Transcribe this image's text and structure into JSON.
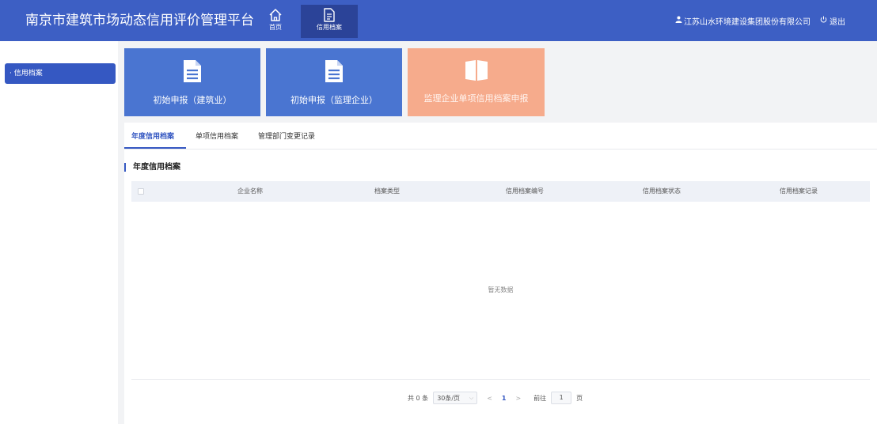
{
  "header": {
    "app_title": "南京市建筑市场动态信用评价管理平台",
    "nav": [
      {
        "label": "首页",
        "icon": "home-icon"
      },
      {
        "label": "信用档案",
        "icon": "document-icon"
      }
    ],
    "company": "江苏山水环境建设集团股份有限公司",
    "logout_label": "退出"
  },
  "sidebar": {
    "items": [
      {
        "label": "· 信用档案"
      }
    ]
  },
  "cards": [
    {
      "label": "初始申报（建筑业）",
      "icon": "document-icon"
    },
    {
      "label": "初始申报（监理企业）",
      "icon": "document-icon"
    },
    {
      "label": "监理企业单项信用档案申报",
      "icon": "book-icon"
    }
  ],
  "tabs": [
    {
      "label": "年度信用档案"
    },
    {
      "label": "单项信用档案"
    },
    {
      "label": "管理部门变更记录"
    }
  ],
  "section": {
    "title": "年度信用档案"
  },
  "table": {
    "columns": [
      "企业名称",
      "档案类型",
      "信用档案编号",
      "信用档案状态",
      "信用档案记录"
    ],
    "empty_text": "暂无数据"
  },
  "pagination": {
    "total": "共 0 条",
    "page_size": "30条/页",
    "prev": "<",
    "current_page": "1",
    "next": ">",
    "goto_label": "前往",
    "goto_value": "1",
    "page_unit": "页"
  },
  "colors": {
    "header_bg": "#3d5fc4",
    "accent": "#3558c2",
    "card_blue": "#4a75d1",
    "card_orange": "#f6ab8c"
  }
}
